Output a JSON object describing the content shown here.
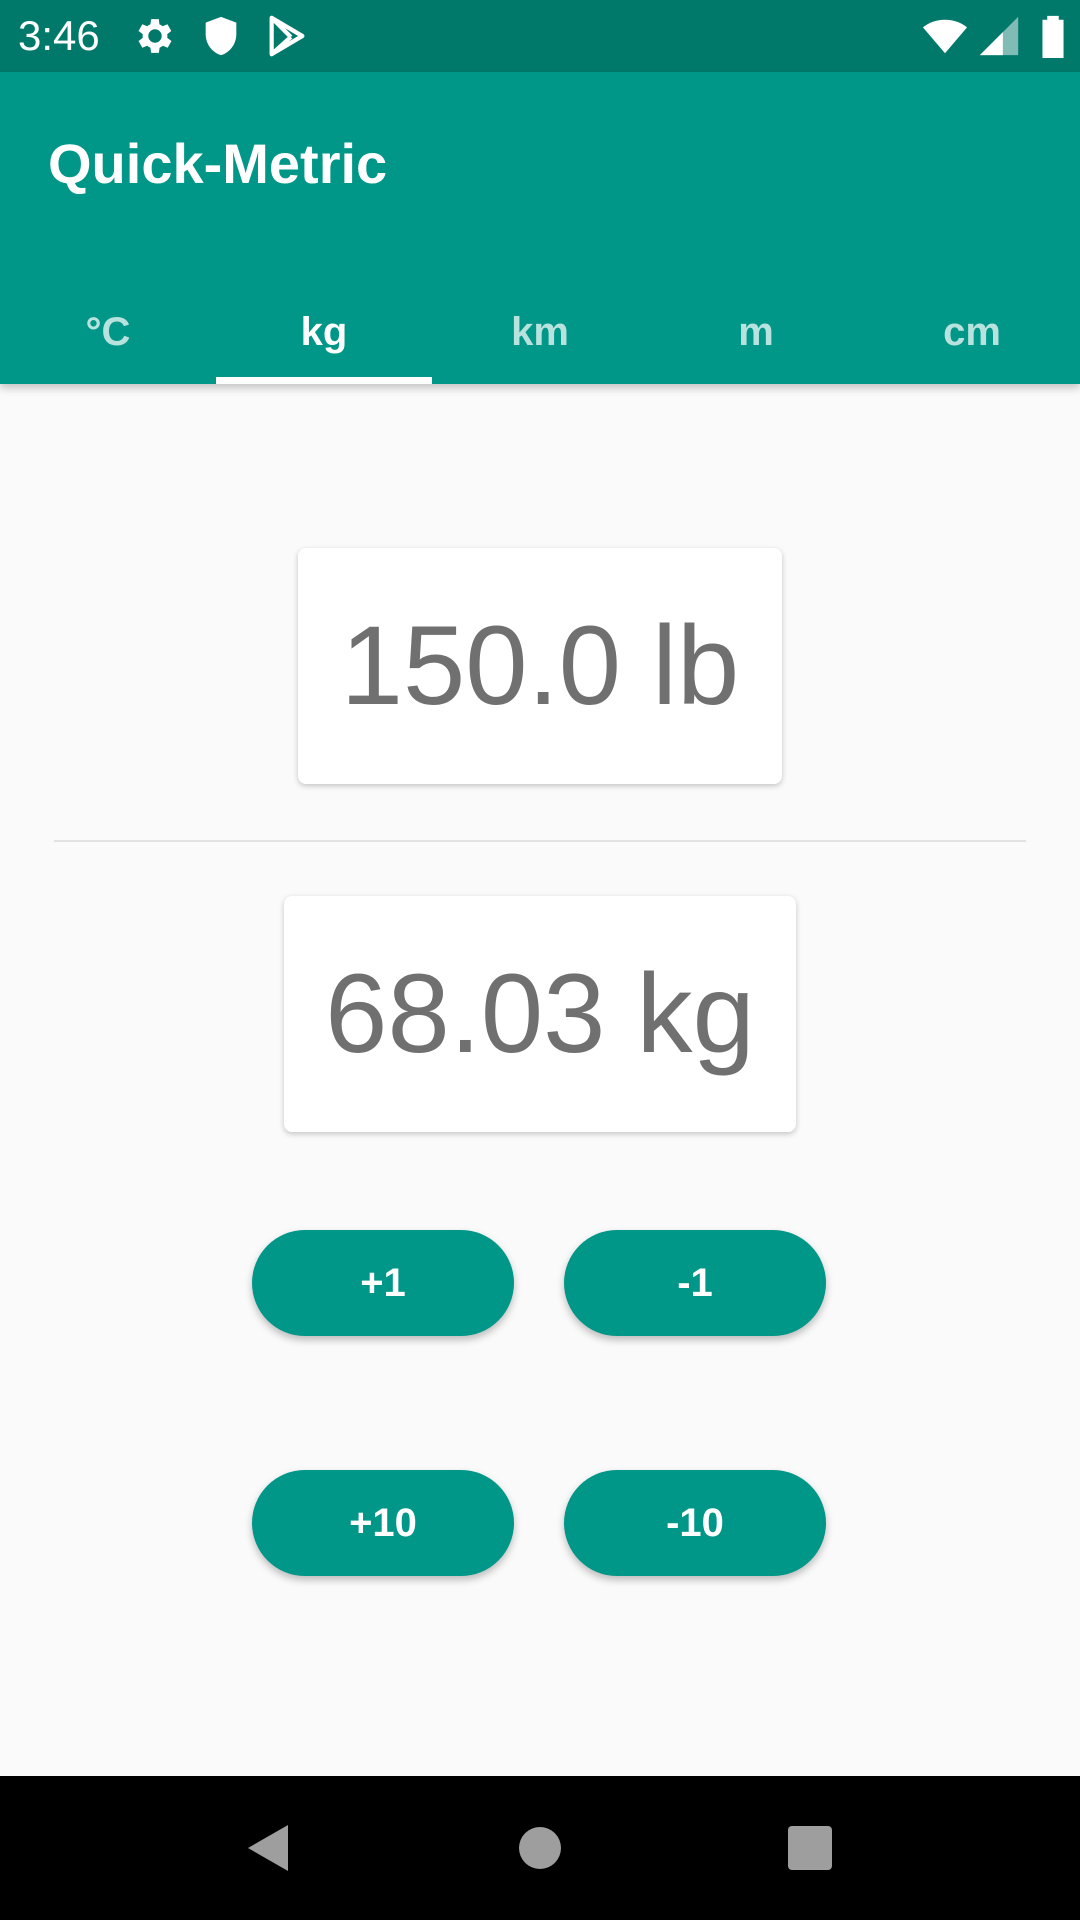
{
  "status_bar": {
    "time": "3:46",
    "icons": [
      "gear-icon",
      "shield-icon",
      "play-store-icon",
      "wifi-icon",
      "signal-icon",
      "battery-icon"
    ]
  },
  "app_bar": {
    "title": "Quick-Metric",
    "tabs": [
      {
        "label": "°C",
        "active": false
      },
      {
        "label": "kg",
        "active": true
      },
      {
        "label": "km",
        "active": false
      },
      {
        "label": "m",
        "active": false
      },
      {
        "label": "cm",
        "active": false
      }
    ]
  },
  "converter": {
    "input_value": "150.0 lb",
    "output_value": "68.03 kg"
  },
  "buttons": {
    "plus_one": "+1",
    "minus_one": "-1",
    "plus_ten": "+10",
    "minus_ten": "-10"
  },
  "nav_bar": {
    "icons": [
      "back-icon",
      "home-icon",
      "recents-icon"
    ]
  },
  "colors": {
    "primary": "#009688",
    "primary_dark": "#00796b",
    "background": "#fafafa",
    "value_text": "#707070"
  }
}
